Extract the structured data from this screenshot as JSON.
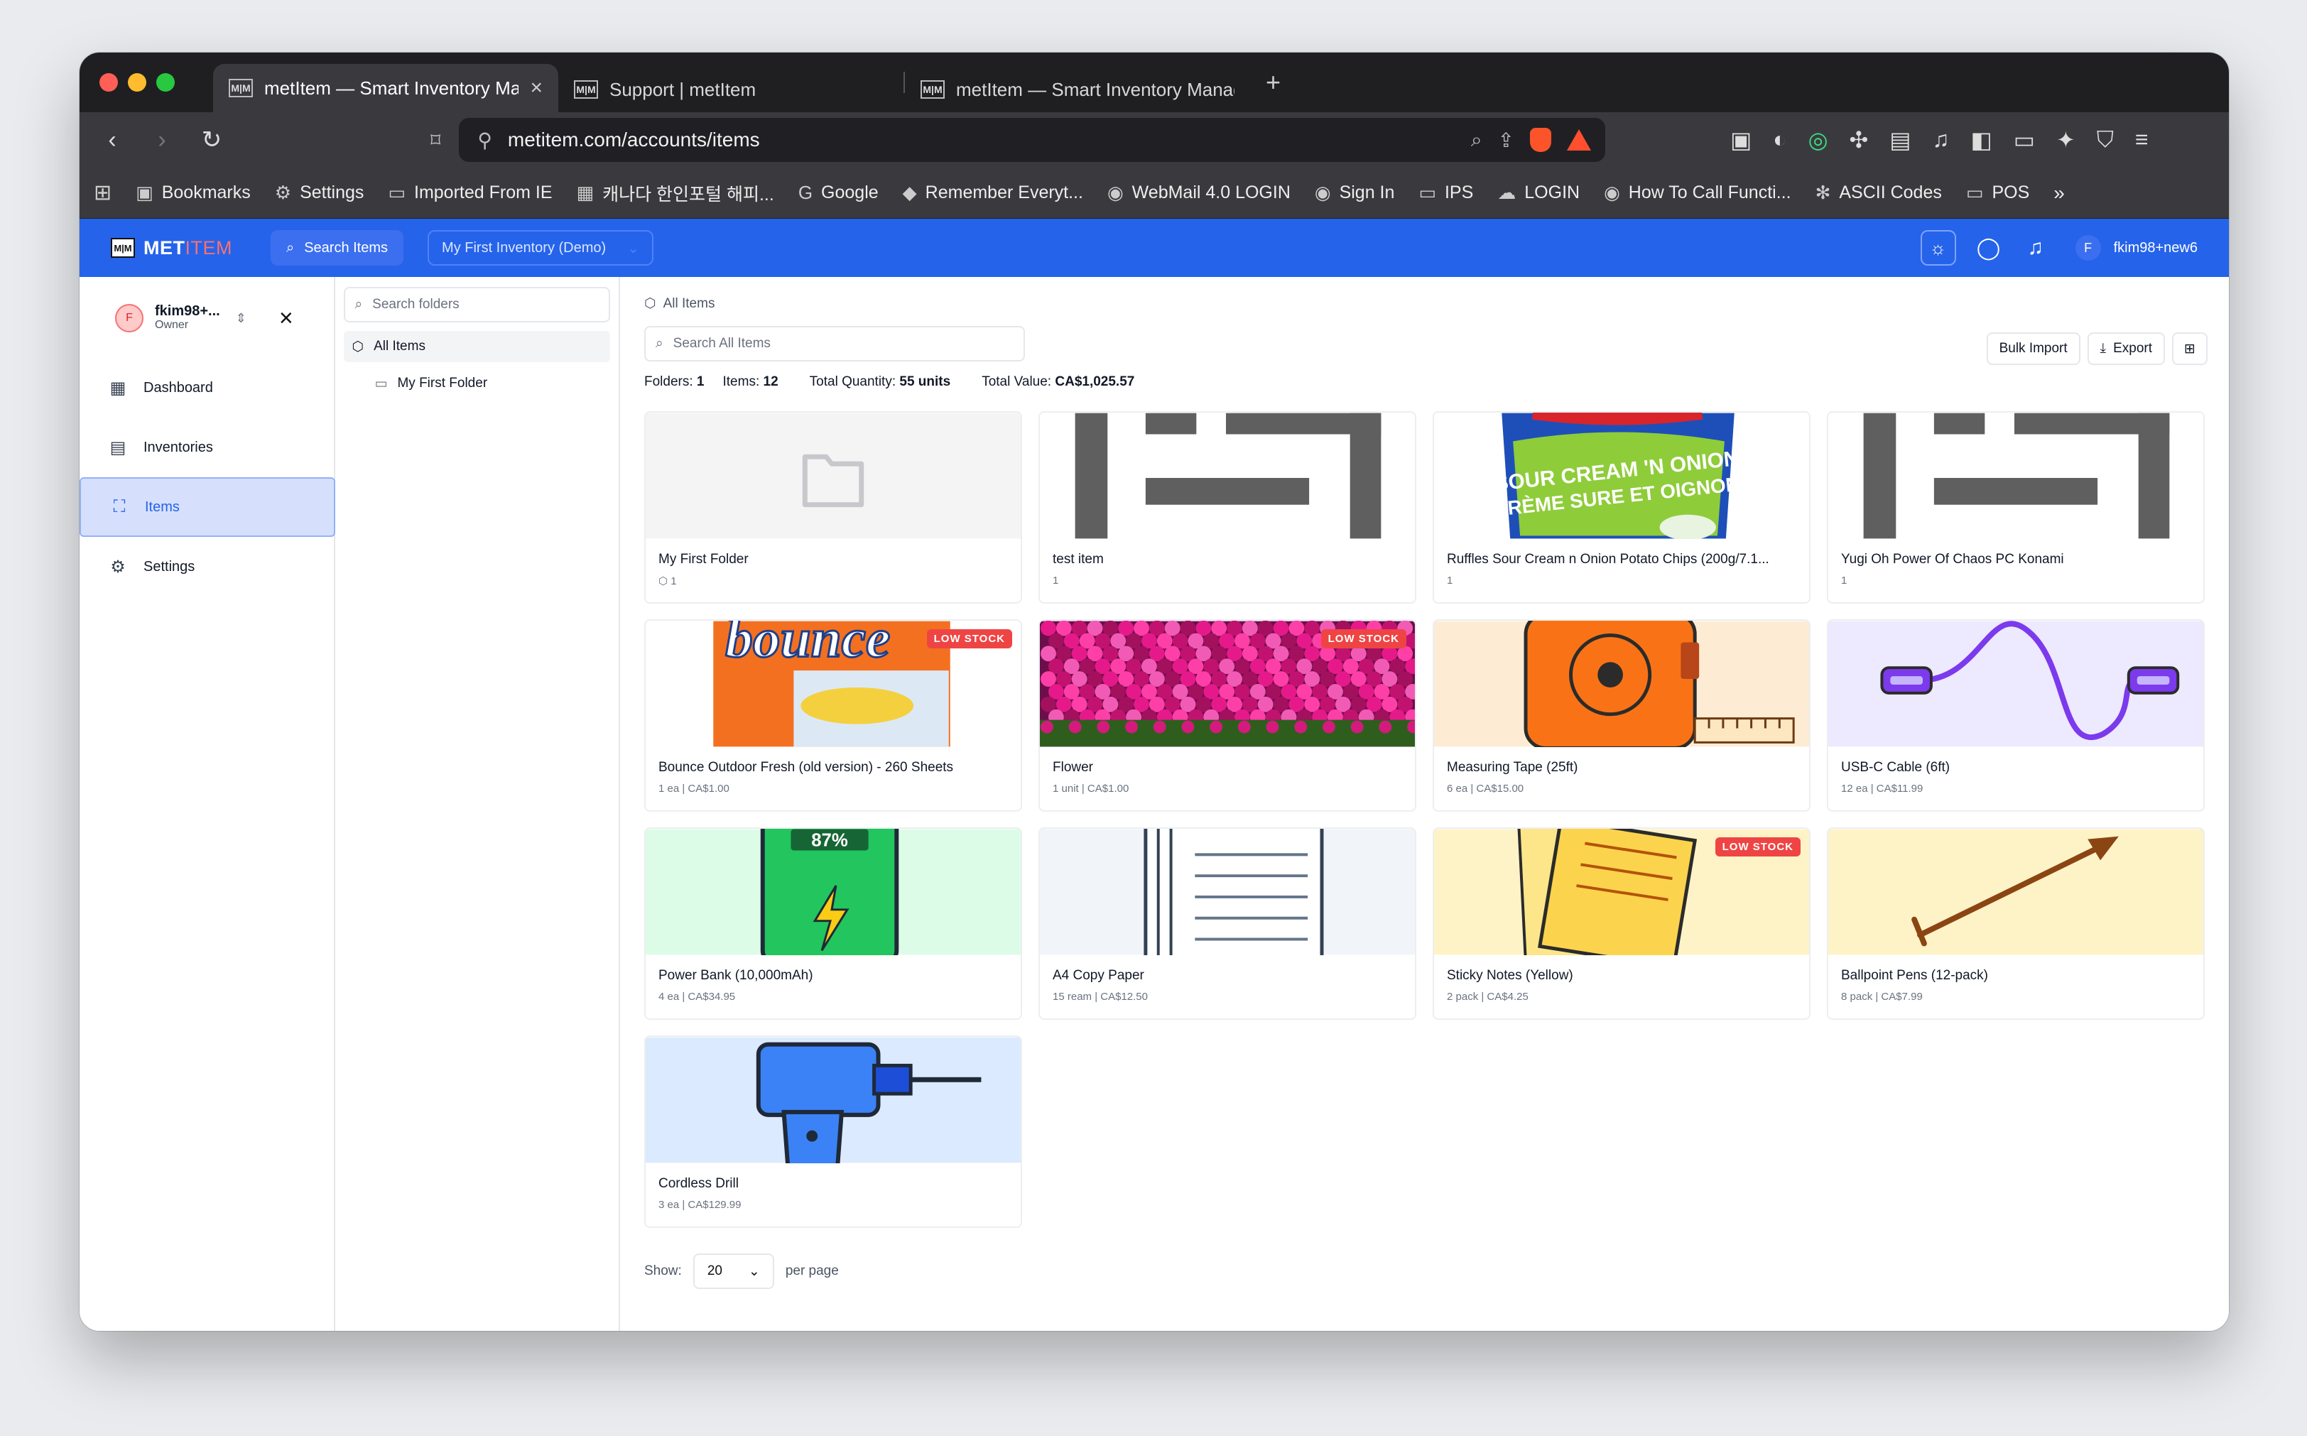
{
  "browser": {
    "tabs": [
      {
        "title": "metItem — Smart Inventory Management",
        "active": true,
        "has_close": true
      },
      {
        "title": "Support | metItem",
        "active": false
      },
      {
        "title": "metItem — Smart Inventory Management",
        "active": false
      }
    ],
    "favicon_text": "M|M",
    "new_tab": "+",
    "url": "metitem.com/accounts/items",
    "bookmarks": [
      {
        "label": "Bookmarks",
        "icon": "bookmarks-icon",
        "glyph": "▣"
      },
      {
        "label": "Settings",
        "icon": "gear-icon",
        "glyph": "⚙"
      },
      {
        "label": "Imported From IE",
        "icon": "folder-icon",
        "glyph": "▭"
      },
      {
        "label": "캐나다 한인포털 해피...",
        "icon": "site-icon",
        "glyph": "▦"
      },
      {
        "label": "Google",
        "icon": "google-icon",
        "glyph": "G"
      },
      {
        "label": "Remember Everyt...",
        "icon": "evernote-icon",
        "glyph": "◆"
      },
      {
        "label": "WebMail 4.0 LOGIN",
        "icon": "globe-icon",
        "glyph": "◉"
      },
      {
        "label": "Sign In",
        "icon": "globe-icon",
        "glyph": "◉"
      },
      {
        "label": "IPS",
        "icon": "folder-icon",
        "glyph": "▭"
      },
      {
        "label": "LOGIN",
        "icon": "cloud-icon",
        "glyph": "☁"
      },
      {
        "label": "How To Call Functi...",
        "icon": "globe-icon",
        "glyph": "◉"
      },
      {
        "label": "ASCII Codes",
        "icon": "snowflake-icon",
        "glyph": "✻"
      },
      {
        "label": "POS",
        "icon": "folder-icon",
        "glyph": "▭"
      }
    ],
    "more": "»"
  },
  "app": {
    "logo_mark": "M|M",
    "logo_a": "MET",
    "logo_b": "ITEM",
    "search_label": "Search Items",
    "inventory": "My First Inventory (Demo)",
    "user": "fkim98+new6",
    "user_initial": "F"
  },
  "sidebar": {
    "account_name": "fkim98+...",
    "account_role": "Owner",
    "account_initial": "F",
    "items": [
      {
        "label": "Dashboard",
        "icon": "dashboard-icon",
        "glyph": "▦",
        "active": false
      },
      {
        "label": "Inventories",
        "icon": "archive-icon",
        "glyph": "▤",
        "active": false
      },
      {
        "label": "Items",
        "icon": "scan-icon",
        "glyph": "⛶",
        "active": true
      },
      {
        "label": "Settings",
        "icon": "gear-icon",
        "glyph": "⚙",
        "active": false
      }
    ]
  },
  "folders": {
    "search_placeholder": "Search folders",
    "all_items": "All Items",
    "children": [
      "My First Folder"
    ]
  },
  "main": {
    "breadcrumb": "All Items",
    "search_placeholder": "Search All Items",
    "bulk_import": "Bulk Import",
    "export": "Export",
    "stats": {
      "folders_label": "Folders:",
      "folders": "1",
      "items_label": "Items:",
      "items": "12",
      "qty_label": "Total Quantity:",
      "qty": "55 units",
      "value_label": "Total Value:",
      "value": "CA$1,025.57"
    },
    "low_stock_label": "LOW STOCK",
    "cards": [
      {
        "title": "My First Folder",
        "meta": "1",
        "kind": "folder",
        "low": false
      },
      {
        "title": "test item",
        "meta": "1",
        "kind": "placeholder",
        "low": false
      },
      {
        "title": "Ruffles Sour Cream n Onion Potato Chips (200g/7.1...",
        "meta": "1",
        "kind": "chips",
        "low": false
      },
      {
        "title": "Yugi Oh Power Of Chaos PC Konami",
        "meta": "1",
        "kind": "placeholder",
        "low": false
      },
      {
        "title": "Bounce Outdoor Fresh (old version) - 260 Sheets",
        "meta": "1 ea | CA$1.00",
        "kind": "bounce",
        "low": true
      },
      {
        "title": "Flower",
        "meta": "1 unit | CA$1.00",
        "kind": "flower",
        "low": true
      },
      {
        "title": "Measuring Tape (25ft)",
        "meta": "6 ea | CA$15.00",
        "kind": "tape",
        "low": false
      },
      {
        "title": "USB-C Cable (6ft)",
        "meta": "12 ea | CA$11.99",
        "kind": "cable",
        "low": false
      },
      {
        "title": "Power Bank (10,000mAh)",
        "meta": "4 ea | CA$34.95",
        "kind": "powerbank",
        "low": false
      },
      {
        "title": "A4 Copy Paper",
        "meta": "15 ream | CA$12.50",
        "kind": "paper",
        "low": false
      },
      {
        "title": "Sticky Notes (Yellow)",
        "meta": "2 pack | CA$4.25",
        "kind": "sticky",
        "low": true
      },
      {
        "title": "Ballpoint Pens (12-pack)",
        "meta": "8 pack | CA$7.99",
        "kind": "pen",
        "low": false
      },
      {
        "title": "Cordless Drill",
        "meta": "3 ea | CA$129.99",
        "kind": "drill",
        "low": false
      }
    ],
    "chips_text_1": "SOUR CREAM 'N ONION",
    "chips_text_2": "CRÈME SURE ET OIGNON",
    "bounce_text": "bounce",
    "powerbank_text": "87%",
    "show_label": "Show:",
    "per_page_value": "20",
    "per_page_label": "per page"
  }
}
